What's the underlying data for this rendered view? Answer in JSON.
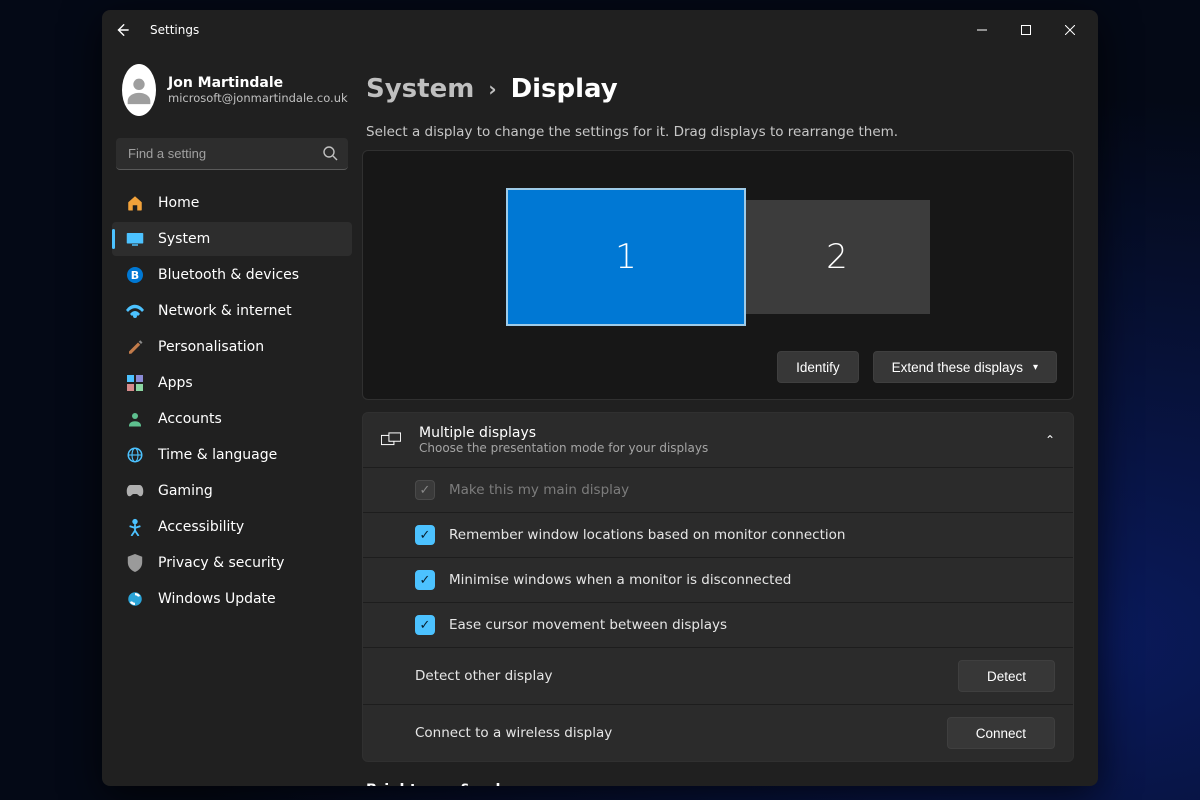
{
  "window": {
    "title": "Settings"
  },
  "profile": {
    "name": "Jon Martindale",
    "email": "microsoft@jonmartindale.co.uk"
  },
  "search": {
    "placeholder": "Find a setting"
  },
  "nav": {
    "items": [
      {
        "label": "Home",
        "icon": "🏠"
      },
      {
        "label": "System",
        "icon": "🖥️"
      },
      {
        "label": "Bluetooth & devices",
        "icon": "B"
      },
      {
        "label": "Network & internet",
        "icon": "📶"
      },
      {
        "label": "Personalisation",
        "icon": "🖌️"
      },
      {
        "label": "Apps",
        "icon": "▦"
      },
      {
        "label": "Accounts",
        "icon": "👤"
      },
      {
        "label": "Time & language",
        "icon": "🌐"
      },
      {
        "label": "Gaming",
        "icon": "🎮"
      },
      {
        "label": "Accessibility",
        "icon": "♿"
      },
      {
        "label": "Privacy & security",
        "icon": "🛡️"
      },
      {
        "label": "Windows Update",
        "icon": "🔄"
      }
    ],
    "active_index": 1
  },
  "breadcrumb": {
    "parent": "System",
    "current": "Display"
  },
  "helper_text": "Select a display to change the settings for it. Drag displays to rearrange them.",
  "monitors": {
    "primary": "1",
    "secondary": "2"
  },
  "actions": {
    "identify": "Identify",
    "extend": "Extend these displays"
  },
  "multi": {
    "title": "Multiple displays",
    "subtitle": "Choose the presentation mode for your displays",
    "opts": {
      "main": "Make this my main display",
      "remember": "Remember window locations based on monitor connection",
      "minimise": "Minimise windows when a monitor is disconnected",
      "ease": "Ease cursor movement between displays",
      "detect_label": "Detect other display",
      "detect_btn": "Detect",
      "connect_label": "Connect to a wireless display",
      "connect_btn": "Connect"
    }
  },
  "brightness_heading": "Brightness & colour"
}
